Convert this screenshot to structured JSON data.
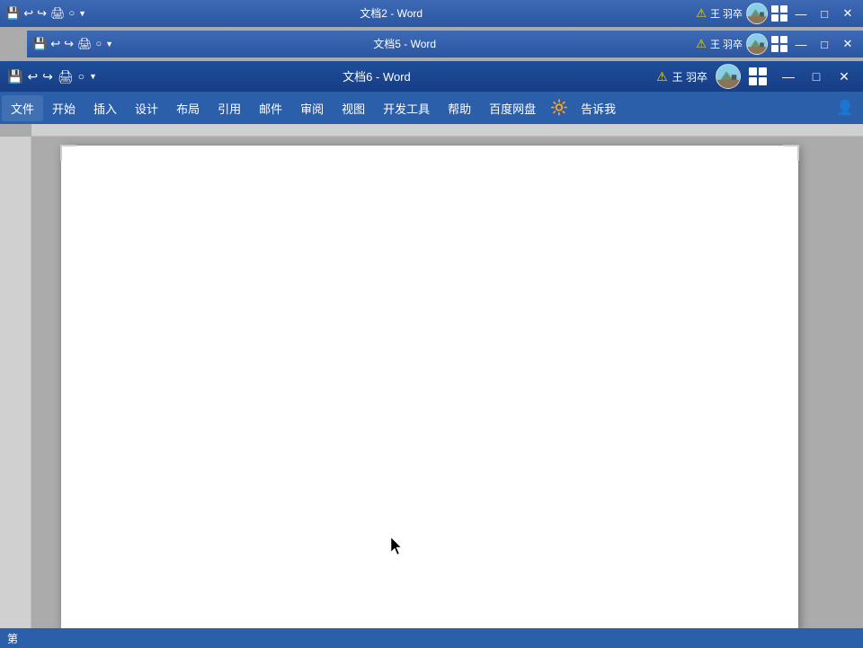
{
  "windows": [
    {
      "id": "win1",
      "title": "文档2  -  Word",
      "z": 1,
      "userName": "王 羽卒",
      "warnIcon": "⚠",
      "controls": [
        "—",
        "□",
        "✕"
      ]
    },
    {
      "id": "win2",
      "title": "文档5  -  Word",
      "z": 2,
      "userName": "王 羽卒",
      "warnIcon": "⚠",
      "controls": [
        "—",
        "□",
        "✕"
      ]
    },
    {
      "id": "win3",
      "title": "文档6  -  Word",
      "z": 3,
      "userName": "王 羽卒",
      "warnIcon": "⚠",
      "controls": [
        "—",
        "□",
        "✕"
      ]
    }
  ],
  "quickAccess": {
    "icons": [
      "💾",
      "↩",
      "↪",
      "🖨",
      "○",
      "▼"
    ]
  },
  "menuBar": {
    "items": [
      "文件",
      "开始",
      "插入",
      "设计",
      "布局",
      "引用",
      "邮件",
      "审阅",
      "视图",
      "开发工具",
      "帮助",
      "百度网盘",
      "🔆",
      "告诉我"
    ]
  },
  "statusBar": {
    "pageInfo": "第",
    "userSearch": "○"
  },
  "document": {
    "title": "文档6",
    "content": ""
  },
  "colors": {
    "titlebarActive": "#1f5099",
    "titlebarInactive": "#2b5faa",
    "ribbonBg": "#2b5faa",
    "docBg": "#ababab",
    "pageBg": "#ffffff"
  }
}
